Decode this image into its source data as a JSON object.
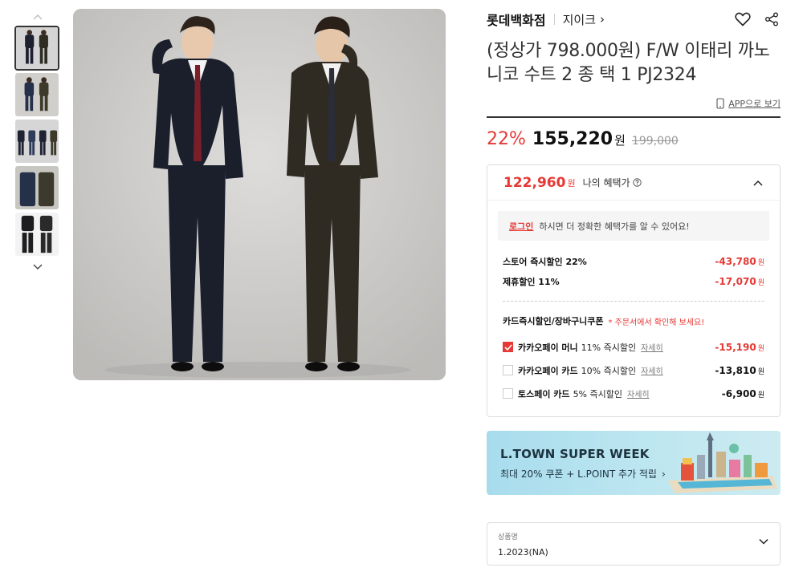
{
  "thumbnails": {
    "up_icon": "chevron-up-icon",
    "down_icon": "chevron-down-icon",
    "items": [
      "thumb-1",
      "thumb-2",
      "thumb-3",
      "thumb-4",
      "thumb-5"
    ],
    "active_index": 0
  },
  "store": {
    "name": "롯데백화점",
    "brand": "지이크",
    "brand_chevron": "›"
  },
  "product": {
    "title": "(정상가 798.000원) F/W 이태리 까노니코 수트 2 종 택 1 PJ2324"
  },
  "app_link": {
    "label": "APP으로 보기"
  },
  "price": {
    "discount_rate": "22%",
    "sale_price": "155,220",
    "unit": "원",
    "original_price": "199,000"
  },
  "benefit": {
    "price": "122,960",
    "unit": "원",
    "label": "나의 혜택가",
    "login_link": "로그인",
    "login_message": "하시면 더 정확한 혜택가를 알 수 있어요!",
    "discounts": [
      {
        "label": "스토어 즉시할인 22%",
        "amount": "-43,780",
        "unit": "원"
      },
      {
        "label": "제휴할인 11%",
        "amount": "-17,070",
        "unit": "원"
      }
    ],
    "coupon_title": "카드즉시할인/장바구니쿠폰",
    "coupon_note": "* 주문서에서 확인해 보세요!",
    "coupons": [
      {
        "name": "카카오페이 머니",
        "desc": "11% 즉시할인",
        "detail": "자세히",
        "amount": "-15,190",
        "unit": "원",
        "checked": true
      },
      {
        "name": "카카오페이 카드",
        "desc": "10% 즉시할인",
        "detail": "자세히",
        "amount": "-13,810",
        "unit": "원",
        "checked": false
      },
      {
        "name": "토스페이 카드",
        "desc": "5% 즉시할인",
        "detail": "자세히",
        "amount": "-6,900",
        "unit": "원",
        "checked": false
      }
    ]
  },
  "banner": {
    "title": "L.TOWN SUPER WEEK",
    "subtitle": "최대 20% 쿠폰 + L.POINT 추가 적립",
    "chevron": "›"
  },
  "option_select": {
    "label": "상품명",
    "value": "1.2023(NA)"
  },
  "colors": {
    "accent_red": "#e53935",
    "banner_bg": "#b4e1ee"
  }
}
